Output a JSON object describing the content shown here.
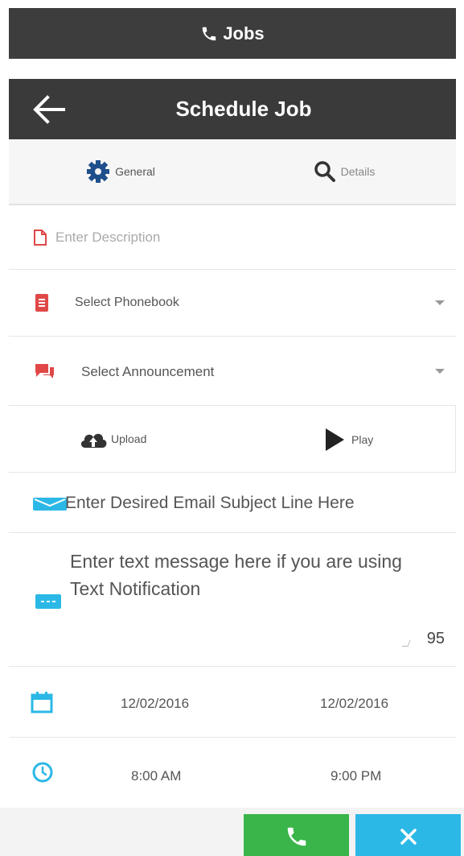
{
  "top_bar": {
    "label": "Jobs"
  },
  "header": {
    "title": "Schedule Job"
  },
  "tabs": [
    {
      "label": "General",
      "icon": "gear-icon"
    },
    {
      "label": "Details",
      "icon": "search-icon"
    }
  ],
  "description": {
    "placeholder": "Enter Description"
  },
  "phonebook": {
    "label": "Select Phonebook"
  },
  "announcement": {
    "label": "Select Announcement"
  },
  "media": {
    "upload_label": "Upload",
    "play_label": "Play"
  },
  "email_subject": {
    "placeholder": "Enter Desired Email Subject Line Here"
  },
  "sms": {
    "placeholder": "Enter text message here if you are using Text Notification",
    "counter": "95"
  },
  "dates": {
    "start": "12/02/2016",
    "end": "12/02/2016"
  },
  "times": {
    "start": "8:00 AM",
    "end": "9:00 PM"
  },
  "colors": {
    "call": "#39b54a",
    "close": "#2bb8e6",
    "header": "#3a3a3a"
  }
}
